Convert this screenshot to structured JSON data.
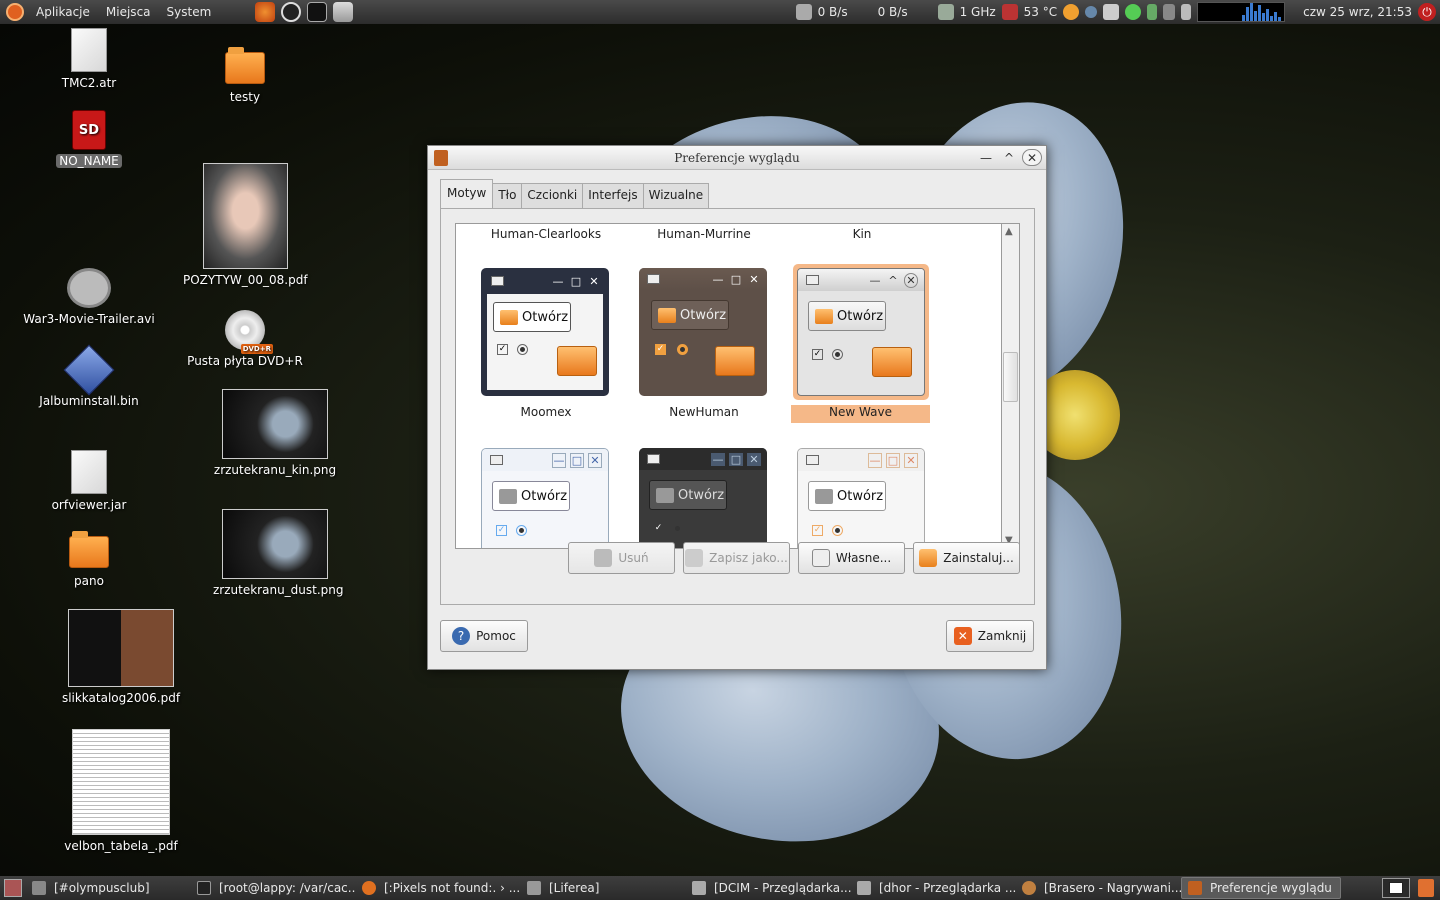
{
  "top_panel": {
    "menus": [
      "Aplikacje",
      "Miejsca",
      "System"
    ],
    "net_down": "0 B/s",
    "net_up": "0 B/s",
    "cpu_freq": "1 GHz",
    "temperature": "53 °C",
    "clock": "czw 25 wrz, 21:53"
  },
  "desktop_icons": [
    {
      "label": "TMC2.atr"
    },
    {
      "label": "NO_NAME"
    },
    {
      "label": "War3-Movie-Trailer.avi"
    },
    {
      "label": "Jalbuminstall.bin"
    },
    {
      "label": "orfviewer.jar"
    },
    {
      "label": "pano"
    },
    {
      "label": "slikkatalog2006.pdf"
    },
    {
      "label": "velbon_tabela_.pdf"
    },
    {
      "label": "testy"
    },
    {
      "label": "POZYTYW_00_08.pdf"
    },
    {
      "label": "Pusta płyta DVD+R"
    },
    {
      "label": "zrzutekranu_kin.png"
    },
    {
      "label": "zrzutekranu_dust.png"
    }
  ],
  "sd_badge": "SD",
  "dvd_badge": "DVD+R",
  "window": {
    "title": "Preferencje wyglądu",
    "tabs": [
      "Motyw",
      "Tło",
      "Czcionki",
      "Interfejs",
      "Wizualne"
    ],
    "themes_row1": [
      "Human-Clearlooks",
      "Human-Murrine",
      "Kin"
    ],
    "themes_row2": [
      "Moomex",
      "NewHuman",
      "New Wave"
    ],
    "selected_theme": "New Wave",
    "preview_button_label": "Otwórz",
    "buttons": {
      "remove": "Usuń",
      "save_as": "Zapisz jako...",
      "custom": "Własne...",
      "install": "Zainstaluj...",
      "help": "Pomoc",
      "close": "Zamknij"
    }
  },
  "taskbar": [
    {
      "label": "[#olympusclub]"
    },
    {
      "label": "[root@lappy: /var/cac..."
    },
    {
      "label": "[:Pixels not found:. › ..."
    },
    {
      "label": "[Liferea]"
    },
    {
      "label": "[DCIM - Przeglądarka..."
    },
    {
      "label": "[dhor - Przeglądarka ..."
    },
    {
      "label": "[Brasero - Nagrywani..."
    },
    {
      "label": "Preferencje wyglądu"
    }
  ],
  "colors": {
    "selection": "#f5b888",
    "panel": "#333333",
    "accent_orange": "#e8781c"
  }
}
